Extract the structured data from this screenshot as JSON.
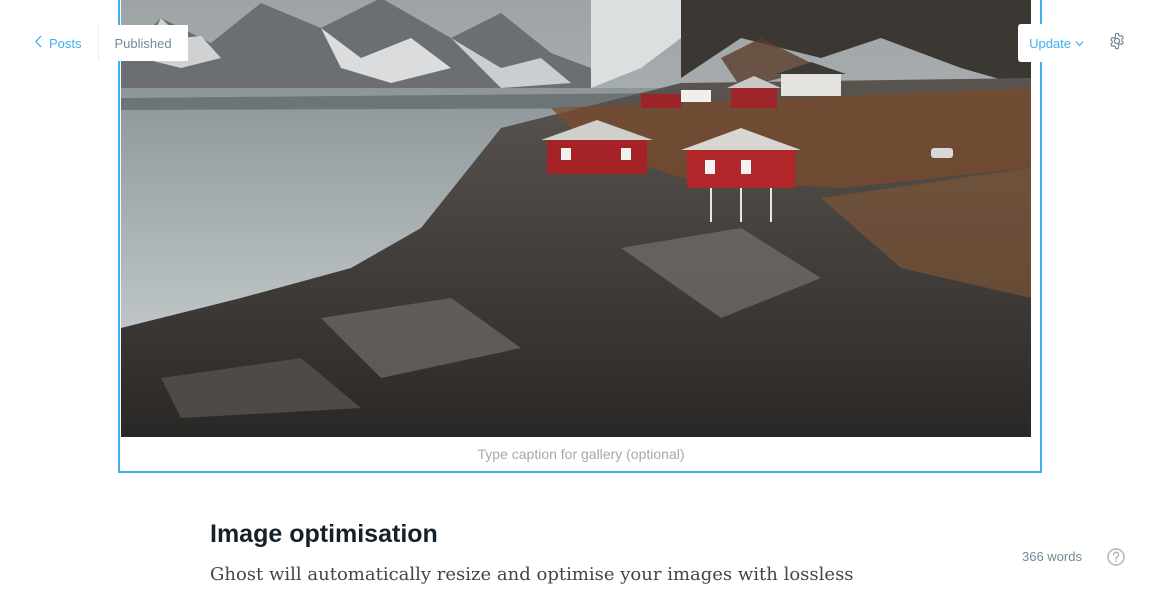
{
  "header": {
    "back_label": "Posts",
    "status": "Published",
    "update_label": "Update",
    "icons": [
      "chevron-left-icon",
      "chevron-down-icon",
      "settings-gear-icon"
    ]
  },
  "gallery": {
    "caption_placeholder": "Type caption for gallery (optional)",
    "image_description_alt": "Fjord with snowy mountains and red wooden cabins on rocky shore"
  },
  "content": {
    "heading": "Image optimisation",
    "paragraph": "Ghost will automatically resize and optimise your images with lossless"
  },
  "footer": {
    "word_count": "366 words",
    "help_icon": "question-circle-icon"
  },
  "colors": {
    "accent": "#3eb0ef",
    "muted": "#738a94",
    "heading": "#15212a"
  }
}
